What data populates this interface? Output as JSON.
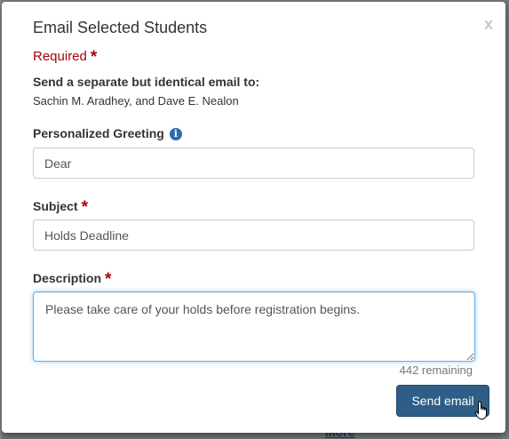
{
  "background": {
    "link_text": "More"
  },
  "modal": {
    "title": "Email Selected Students",
    "close_label": "x",
    "required_note": "Required",
    "required_marker": "*",
    "recipients_label": "Send a separate but identical email to:",
    "recipients": "Sachin M. Aradhey, and Dave E. Nealon",
    "greeting": {
      "label": "Personalized Greeting",
      "value": "Dear",
      "info_icon": "info-icon"
    },
    "subject": {
      "label": "Subject",
      "value": "Holds Deadline"
    },
    "description": {
      "label": "Description",
      "value": "Please take care of your holds before registration begins.",
      "remaining": "442 remaining"
    },
    "send_label": "Send email"
  },
  "colors": {
    "accent": "#2e5e87",
    "required": "#a8000c",
    "focus": "#66afe9"
  }
}
